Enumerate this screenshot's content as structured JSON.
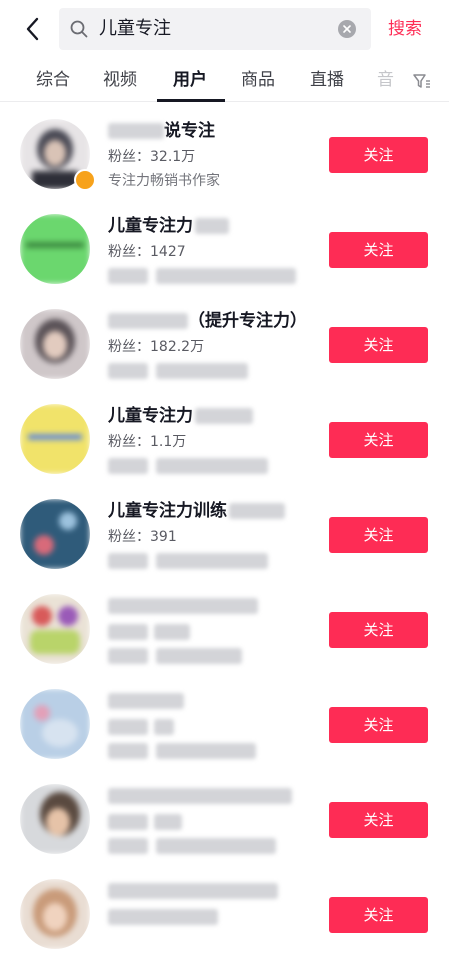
{
  "search": {
    "query": "儿童专注",
    "submit_label": "搜索"
  },
  "tabs": [
    {
      "label": "综合"
    },
    {
      "label": "视频"
    },
    {
      "label": "用户"
    },
    {
      "label": "商品"
    },
    {
      "label": "直播"
    },
    {
      "label": "音"
    }
  ],
  "fans_prefix": "粉丝：",
  "follow_label": "关注",
  "results": [
    {
      "name": "说专注",
      "fans": "32.1万",
      "desc": "专注力畅销书作家"
    },
    {
      "name": "儿童专注力",
      "fans": "1427",
      "desc": ""
    },
    {
      "name": "（提升专注力）",
      "fans": "182.2万",
      "desc": ""
    },
    {
      "name": "儿童专注力",
      "fans": "1.1万",
      "desc": ""
    },
    {
      "name": "儿童专注力训练",
      "fans": "391",
      "desc": ""
    },
    {
      "name": "",
      "fans": "",
      "desc": ""
    },
    {
      "name": "",
      "fans": "",
      "desc": ""
    },
    {
      "name": "",
      "fans": "",
      "desc": ""
    },
    {
      "name": "",
      "fans": "",
      "desc": ""
    }
  ],
  "colors": {
    "accent": "#fe2c55",
    "avatar_0": "#4a4a55",
    "avatar_1": "#6bd76e",
    "avatar_2": "#5b5358",
    "avatar_3": "#f1e36a",
    "avatar_4": "#2f5b7a",
    "avatar_5": "#b9d46a",
    "avatar_6": "#b9cfe6",
    "avatar_7": "#5a4a40",
    "avatar_8": "#c99b7a"
  }
}
